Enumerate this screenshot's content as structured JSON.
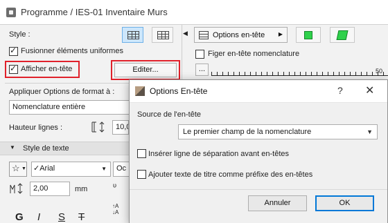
{
  "window": {
    "title": "Programme / IES-01 Inventaire Murs"
  },
  "left": {
    "style_label": "Style :",
    "merge_label": "Fusionner éléments uniformes",
    "show_header_label": "Afficher en-tête",
    "edit_button": "Editer...",
    "apply_format_label": "Appliquer Options de format à :",
    "apply_scope_value": "Nomenclature entière",
    "row_height_label": "Hauteur lignes :",
    "row_height_value": "10,0",
    "text_style_section": "Style de texte",
    "font_value": "Arial",
    "font_variant_value": "Oc",
    "text_size_value": "2,00",
    "text_size_unit": "mm",
    "format_buttons": [
      "G",
      "I",
      "S",
      "T"
    ]
  },
  "right": {
    "header_options_label": "Options en-tête",
    "freeze_header_label": "Figer en-tête nomenclature",
    "more_button": "...",
    "ruler_end_label": "50"
  },
  "dialog": {
    "title": "Options En-tête",
    "help_glyph": "?",
    "close_glyph": "✕",
    "source_label": "Source de l'en-tête",
    "source_value": "Le premier champ de la nomenclature",
    "option1_label": "Insérer ligne de séparation avant en-têtes",
    "option2_label": "Ajouter texte de titre comme préfixe des en-têtes",
    "cancel_button": "Annuler",
    "ok_button": "OK"
  },
  "colors": {
    "highlight": "#e0202a",
    "accent": "#0078d7"
  }
}
